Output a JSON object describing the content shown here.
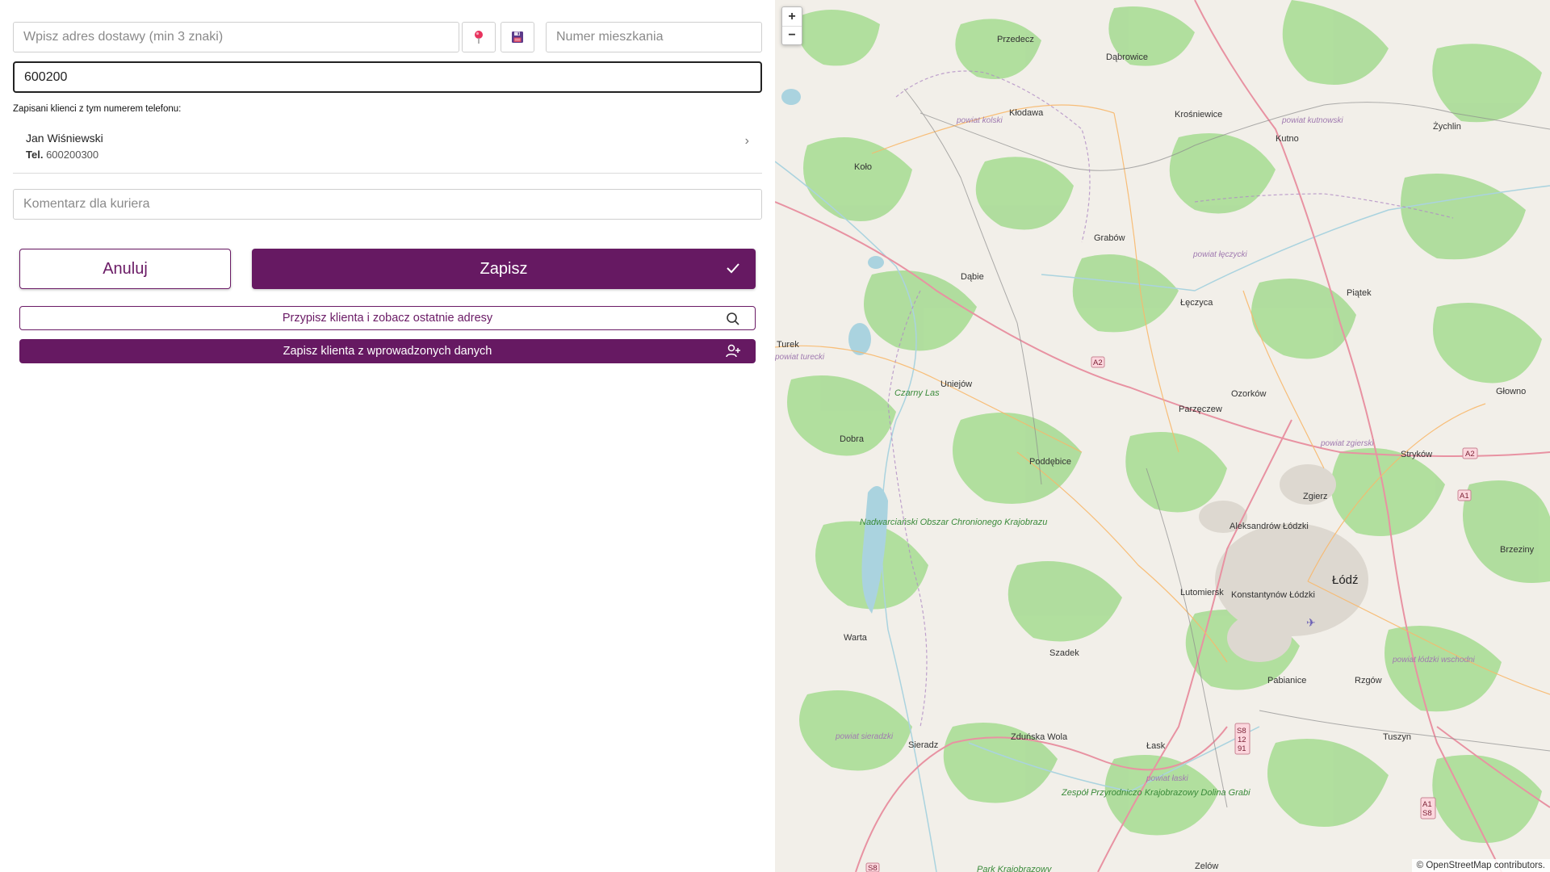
{
  "form": {
    "address_placeholder": "Wpisz adres dostawy (min 3 znaki)",
    "apartment_placeholder": "Numer mieszkania",
    "phone_value": "600200",
    "saved_clients_label": "Zapisani klienci z tym numerem telefonu:",
    "clients": [
      {
        "name": "Jan Wiśniewski",
        "tel_label": "Tel.",
        "tel": "600200300"
      }
    ],
    "comment_placeholder": "Komentarz dla kuriera",
    "cancel_label": "Anuluj",
    "save_label": "Zapisz",
    "assign_label": "Przypisz klienta i zobacz ostatnie adresy",
    "save_client_label": "Zapisz klienta z wprowadzonych danych",
    "icons": {
      "pin": "map-pin-icon",
      "save_address": "floppy-disk-icon",
      "chevron": "chevron-right-icon",
      "check": "check-icon",
      "search": "search-icon",
      "add_user": "user-plus-icon"
    },
    "colors": {
      "primary": "#661962",
      "pin": "#e8335e"
    }
  },
  "map": {
    "zoom_in": "+",
    "zoom_out": "−",
    "attribution_prefix": "©",
    "attribution_link": "OpenStreetMap",
    "attribution_suffix": "contributors.",
    "cities": [
      "Przedecz",
      "Dąbrowice",
      "Kłodawa",
      "Krośniewice",
      "Kutno",
      "Żychlin",
      "Koło",
      "Grabów",
      "Dąbie",
      "Łęczyca",
      "Piątek",
      "Turek",
      "Uniejów",
      "Parzęczew",
      "Ozorków",
      "Głowno",
      "Dobra",
      "Poddębice",
      "Stryków",
      "Zgierz",
      "Brzeziny",
      "Aleksandrów Łódzki",
      "Łódź",
      "Lutomiersk",
      "Konstantynów Łódzki",
      "Warta",
      "Szadek",
      "Pabianice",
      "Rzgów",
      "Sieradz",
      "Zduńska Wola",
      "Łask",
      "Tuszyn",
      "Zelów"
    ],
    "regions": [
      "powiat kolski",
      "powiat kutnowski",
      "powiat łęczycki",
      "powiat zgierski",
      "powiat łódzki wschodni",
      "powiat sieradzki",
      "powiat łaski",
      "powiat turecki"
    ],
    "parks": [
      "Nadwarciański Obszar Chronionego Krajobrazu",
      "Czarny Las",
      "Zespół Przyrodniczo Krajobrazowy Dolina Grabi",
      "Park Krajobrazowy"
    ],
    "road_shields": [
      "A2",
      "A2",
      "A1",
      "S8 12 91",
      "A1 S8",
      "S8"
    ]
  }
}
